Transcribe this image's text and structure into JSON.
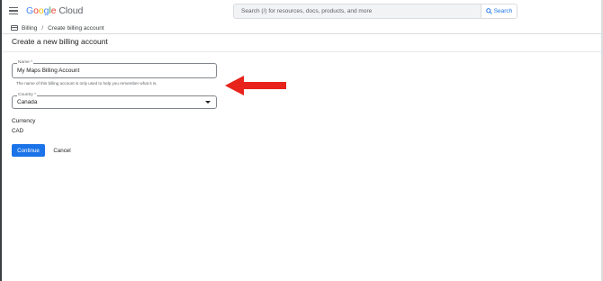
{
  "header": {
    "logo_text": "Google Cloud",
    "search": {
      "placeholder": "Search (/) for resources, docs, products, and more",
      "button_label": "Search"
    }
  },
  "breadcrumb": {
    "items": [
      "Billing",
      "Create billing account"
    ],
    "separator": "/"
  },
  "page": {
    "title": "Create a new billing account"
  },
  "form": {
    "name_field": {
      "label": "Name *",
      "value": "My Maps Billing Account",
      "helper": "The name of this billing account is only used to help you remember what it is."
    },
    "country_field": {
      "label": "Country *",
      "value": "Canada"
    },
    "currency": {
      "heading": "Currency",
      "value": "CAD"
    },
    "buttons": {
      "continue_label": "Continue",
      "cancel_label": "Cancel"
    }
  },
  "annotation": {
    "arrow_color": "#e8231c"
  },
  "colors": {
    "primary": "#1a73e8",
    "text": "#202124",
    "muted": "#5f6368",
    "border": "#dadce0"
  }
}
